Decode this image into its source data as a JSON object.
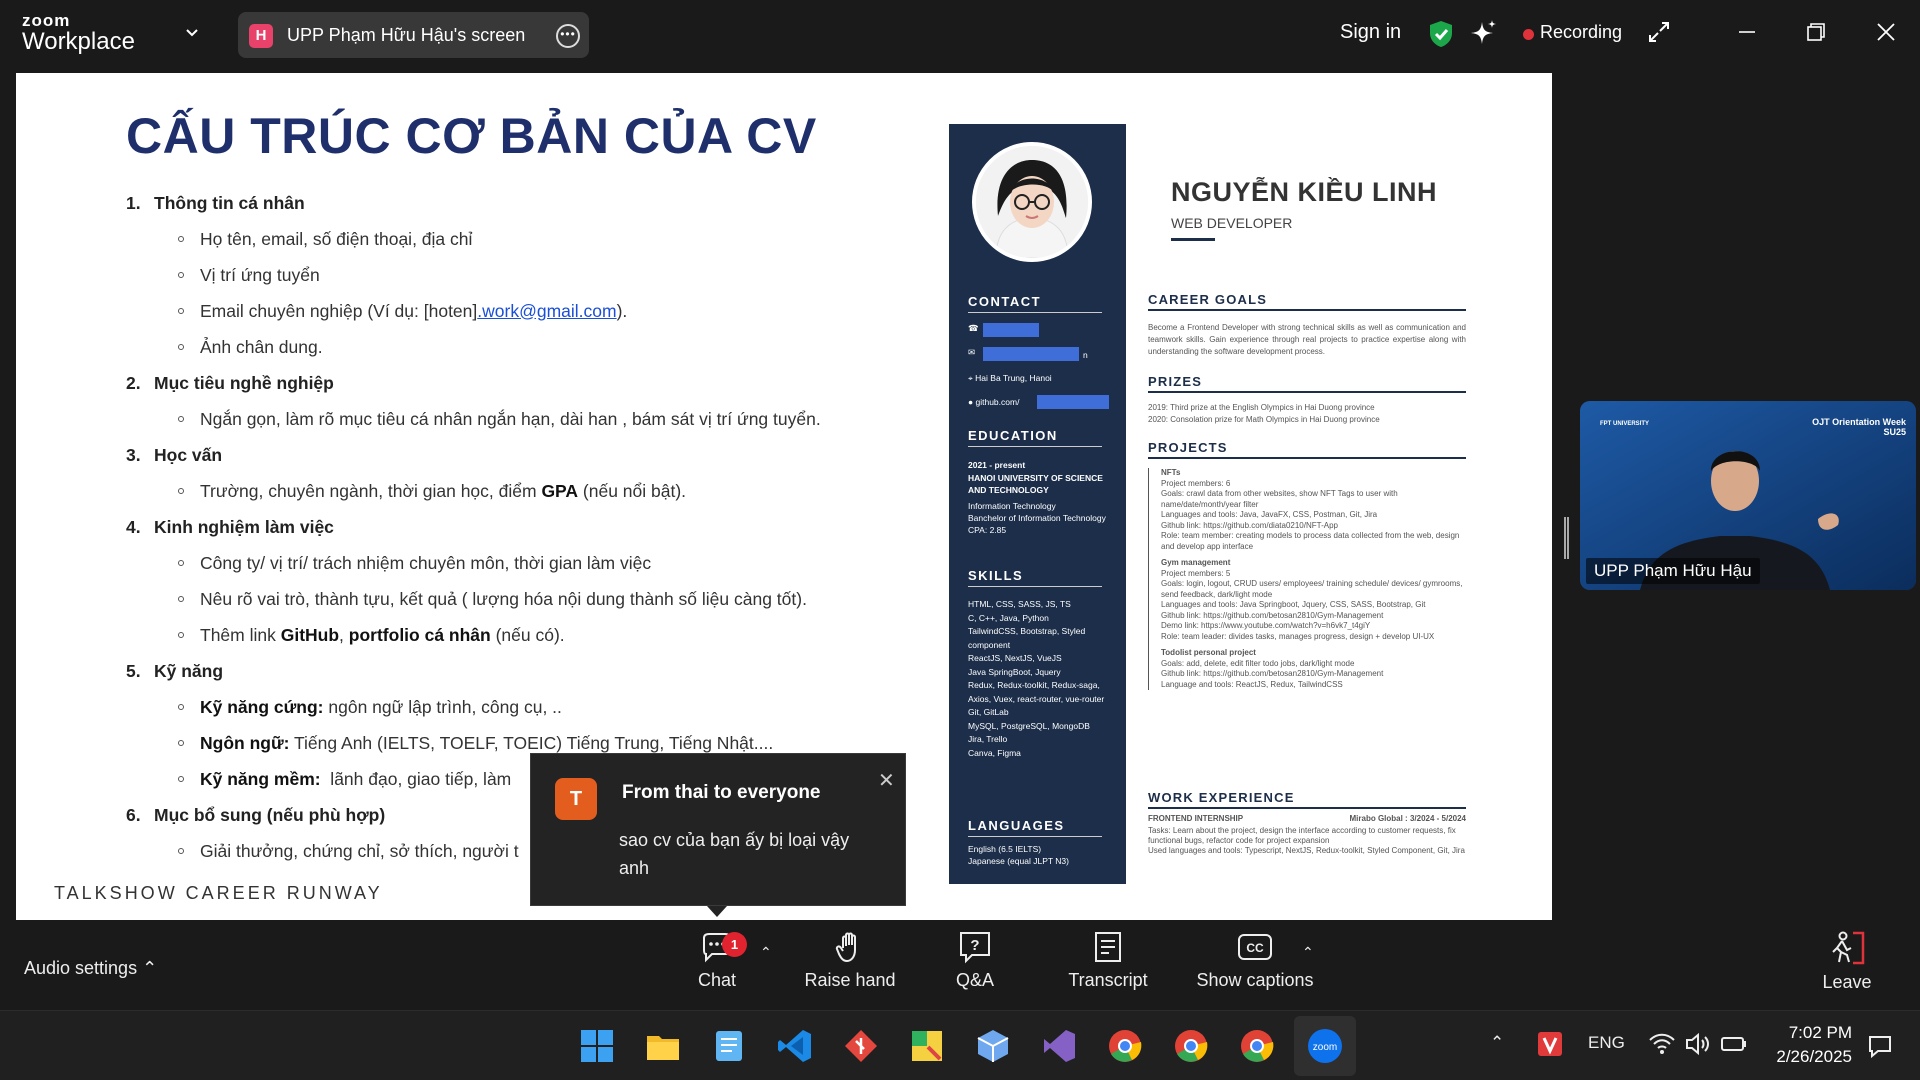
{
  "app": {
    "brand_top": "zoom",
    "brand_bottom": "Workplace"
  },
  "topbar": {
    "share_badge": "H",
    "share_title": "UPP Phạm Hữu Hậu's screen",
    "sign_in": "Sign in",
    "recording": "Recording"
  },
  "slide": {
    "title": "CẤU TRÚC CƠ BẢN CỦA CV",
    "s1": {
      "num": "1.",
      "label": "Thông tin cá nhân",
      "b1": "Họ tên, email, số điện thoại, địa chỉ",
      "b2": "Vị trí ứng tuyển",
      "b3_pre": "Email chuyên nghiệp (Ví dụ: [hoten]",
      "b3_link": ".work@gmail.com",
      "b3_post": ").",
      "b4": "Ảnh chân dung."
    },
    "s2": {
      "num": "2.",
      "label": "Mục tiêu nghề nghiệp",
      "b1": "Ngắn gọn, làm rõ mục tiêu cá nhân ngắn hạn, dài han , bám sát vị trí ứng tuyển."
    },
    "s3": {
      "num": "3.",
      "label": "Học vấn",
      "b1_pre": "Trường, chuyên ngành, thời gian học, điểm ",
      "b1_bold": "GPA",
      "b1_post": " (nếu nổi bật)."
    },
    "s4": {
      "num": "4.",
      "label": "Kinh nghiệm làm việc",
      "b1": "Công ty/ vị trí/ trách nhiệm chuyên môn, thời gian làm việc",
      "b2": "Nêu rõ vai trò, thành tựu, kết quả ( lượng hóa nội dung thành số liệu càng tốt).",
      "b3_pre": "Thêm link ",
      "b3_bold1": "GitHub",
      "b3_mid": ", ",
      "b3_bold2": "portfolio cá nhân",
      "b3_post": " (nếu có)."
    },
    "s5": {
      "num": "5.",
      "label": "Kỹ năng",
      "b1_bold": "Kỹ năng cứng:",
      "b1": " ngôn ngữ lập trình, công cụ, ..",
      "b2_bold": "Ngôn ngữ:",
      "b2": " Tiếng Anh (IELTS, TOELF, TOEIC) Tiếng Trung, Tiếng Nhật....",
      "b3_bold": "Kỹ năng mềm:",
      "b3": "  lãnh đạo, giao tiếp, làm"
    },
    "s6": {
      "num": "6.",
      "label": "Mục bổ sung (nếu phù hợp)",
      "b1": "Giải thưởng, chứng chỉ, sở thích, người t"
    },
    "footer": "TALKSHOW CAREER RUNWAY"
  },
  "cv": {
    "name": "NGUYỄN KIỀU LINH",
    "role": "WEB DEVELOPER",
    "contact_h": "CONTACT",
    "address": "Hai Ba Trung, Hanoi",
    "github": "github.com/",
    "email_suffix": "n",
    "education_h": "EDUCATION",
    "edu_dates": "2021 - present",
    "edu_school": "HANOI UNIVERSITY OF SCIENCE AND TECHNOLOGY",
    "edu_items": [
      "Information Technology",
      "Banchelor of Information Technology",
      "CPA: 2.85"
    ],
    "skills_h": "SKILLS",
    "skills": [
      "HTML, CSS, SASS, JS, TS",
      "C, C++, Java, Python",
      "TailwindCSS, Bootstrap, Styled component",
      "ReactJS, NextJS, VueJS",
      "Java SpringBoot, Jquery",
      "Redux, Redux-toolkit, Redux-saga, Axios, Vuex, react-router, vue-router",
      "Git, GitLab",
      "MySQL, PostgreSQL, MongoDB",
      "Jira, Trello",
      "Canva, Figma"
    ],
    "languages_h": "LANGUAGES",
    "languages": [
      "English (6.5 IELTS)",
      "Japanese (equal JLPT N3)"
    ],
    "goals_h": "CAREER GOALS",
    "goals": "Become a Frontend Developer with strong technical skills as well as communication and teamwork skills. Gain experience through real projects to practice expertise along with understanding the software development process.",
    "prizes_h": "PRIZES",
    "prizes": [
      "2019: Third prize at the English Olympics in Hai Duong province",
      "2020: Consolation prize for Math Olympics in Hai Duong province"
    ],
    "projects_h": "PROJECTS",
    "p1_title": "NFTs",
    "p1_items": [
      "Project members: 6",
      "Goals: crawl data from other websites, show NFT Tags to user with name/date/month/year filter",
      "Languages and tools: Java, JavaFX, CSS, Postman, Git, Jira",
      "Github link: https://github.com/diata0210/NFT-App",
      "Role: team member: creating models to process data collected from the web, design and develop app interface"
    ],
    "p2_title": "Gym management",
    "p2_items": [
      "Project members: 5",
      "Goals: login, logout, CRUD users/ employees/ training schedule/ devices/ gymrooms, send feedback, dark/light mode",
      "Languages and tools: Java Springboot, Jquery, CSS, SASS, Bootstrap, Git",
      "Github link: https://github.com/betosan2810/Gym-Management",
      "Demo link: https://www.youtube.com/watch?v=h6vk7_t4giY",
      "Role: team leader: divides tasks, manages progress, design + develop UI-UX"
    ],
    "p3_title": "Todolist personal project",
    "p3_items": [
      "Goals: add, delete, edit filter todo jobs, dark/light mode",
      "Github link: https://github.com/betosan2810/Gym-Management",
      "Language and tools: ReactJS, Redux, TailwindCSS"
    ],
    "work_h": "WORK EXPERIENCE",
    "work_role": "FRONTEND INTERNSHIP",
    "work_company": "Mirabo Global : 3/2024 - 5/2024",
    "work_items": [
      "Tasks: Learn about the project, design the interface according to customer requests, fix functional bugs, refactor code for project expansion",
      "Used languages and tools: Typescript, NextJS, Redux-toolkit, Styled Component, Git, Jira"
    ]
  },
  "video": {
    "participant": "UPP Phạm Hữu Hậu",
    "banner_left": "FPT UNIVERSITY",
    "banner_right": "OJT Orientation Week SU25"
  },
  "toast": {
    "avatar": "T",
    "from": "From thai to everyone",
    "message": "sao cv của bạn ấy bị loại vậy anh"
  },
  "toolbar": {
    "audio": "Audio settings",
    "chat": "Chat",
    "chat_badge": "1",
    "raise_hand": "Raise hand",
    "qa": "Q&A",
    "transcript": "Transcript",
    "captions": "Show captions",
    "leave": "Leave"
  },
  "taskbar": {
    "lang": "ENG",
    "time": "7:02 PM",
    "date": "2/26/2025"
  },
  "colors": {
    "leave": "#e0323a",
    "accent": "#0e72ed",
    "record": "#e0323a"
  }
}
